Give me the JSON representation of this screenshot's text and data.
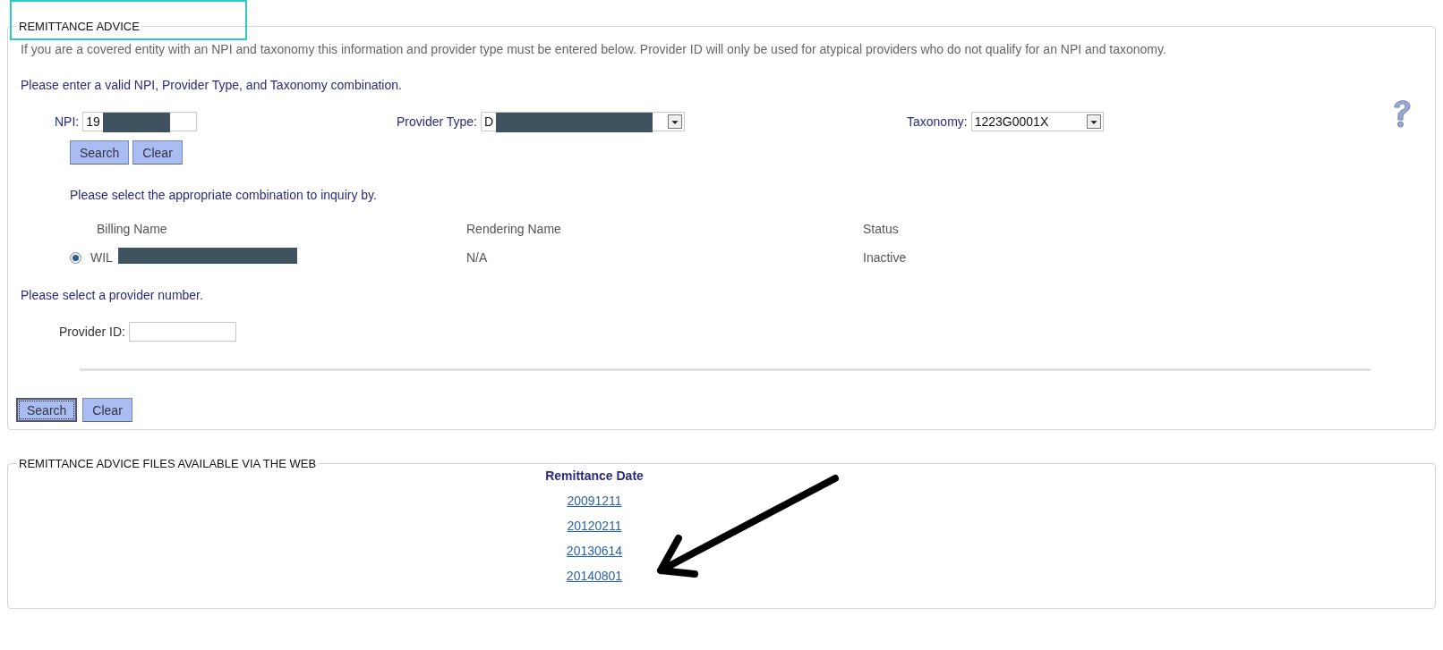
{
  "remittance_advice": {
    "title": "REMITTANCE ADVICE",
    "title_highlighted": true,
    "intro": "If you are a covered entity with an NPI and taxonomy this information and provider type must be entered below. Provider ID will only be used for atypical providers who do not qualify for an NPI and taxonomy.",
    "instruction": "Please enter a valid NPI, Provider Type, and Taxonomy combination.",
    "npi": {
      "label": "NPI:",
      "value": "19",
      "redacted": true
    },
    "provider_type": {
      "label": "Provider Type:",
      "value": "D",
      "redacted": true
    },
    "taxonomy": {
      "label": "Taxonomy:",
      "value": "1223G0001X"
    },
    "lookup_buttons": [
      {
        "label": "Search",
        "focused": false
      },
      {
        "label": "Clear",
        "focused": false
      }
    ],
    "combination_prompt": "Please select the appropriate combination to inquiry by.",
    "combinations": {
      "columns": [
        "Billing Name",
        "Rendering Name",
        "Status"
      ],
      "rows": [
        {
          "selected": true,
          "billing_redacted": true,
          "cells": [
            "WIL",
            "N/A",
            "Inactive"
          ]
        }
      ]
    },
    "provider_prompt": "Please select a provider number.",
    "provider_id": {
      "label": "Provider ID:"
    },
    "buttons": [
      {
        "label": "Search",
        "focused": true
      },
      {
        "label": "Clear",
        "focused": false
      }
    ]
  },
  "files": {
    "title": "REMITTANCE ADVICE FILES AVAILABLE VIA THE WEB",
    "column": "Remittance Date",
    "dates": [
      "20091211",
      "20120211",
      "20130614",
      "20140801"
    ],
    "arrow": true
  }
}
